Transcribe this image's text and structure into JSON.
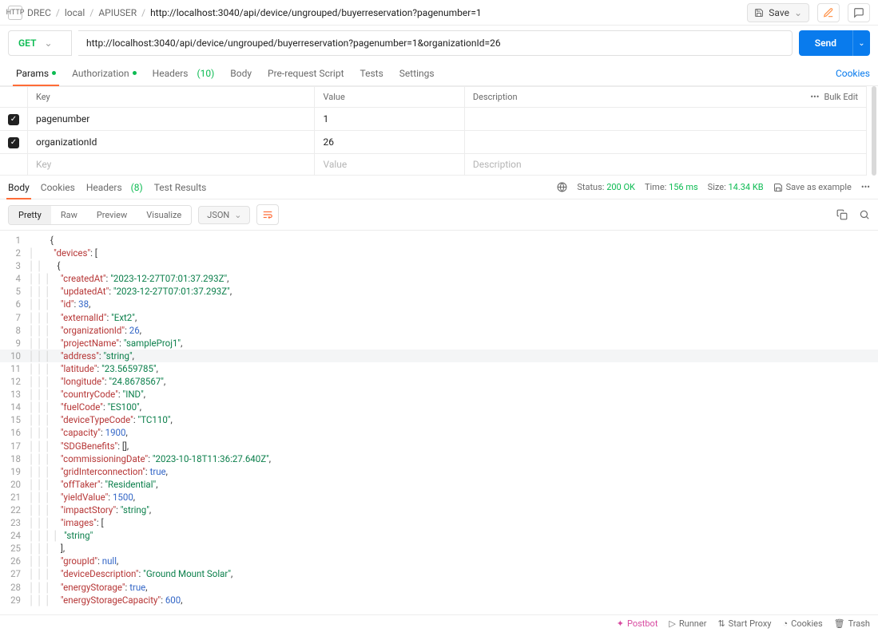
{
  "breadcrumb": {
    "method": "HTTP",
    "a": "DREC",
    "b": "local",
    "c": "APIUSER",
    "url": "http://localhost:3040/api/device/ungrouped/buyerreservation?pagenumber=1"
  },
  "topbar": {
    "save": "Save"
  },
  "request": {
    "method": "GET",
    "url": "http://localhost:3040/api/device/ungrouped/buyerreservation?pagenumber=1&organizationId=26",
    "send": "Send"
  },
  "reqTabs": {
    "params": "Params",
    "auth": "Authorization",
    "headers": "Headers",
    "headers_count": "(10)",
    "body": "Body",
    "prereq": "Pre-request Script",
    "tests": "Tests",
    "settings": "Settings",
    "cookies": "Cookies"
  },
  "paramsHeader": {
    "key": "Key",
    "value": "Value",
    "desc": "Description",
    "bulk": "Bulk Edit"
  },
  "params": [
    {
      "enabled": true,
      "key": "pagenumber",
      "value": "1",
      "desc": ""
    },
    {
      "enabled": true,
      "key": "organizationId",
      "value": "26",
      "desc": ""
    }
  ],
  "newParam": {
    "key": "Key",
    "value": "Value",
    "desc": "Description"
  },
  "respTabs": {
    "body": "Body",
    "cookies": "Cookies",
    "headers": "Headers",
    "headers_count": "(8)",
    "tests": "Test Results"
  },
  "status": {
    "label": "Status:",
    "value": "200 OK",
    "time_label": "Time:",
    "time": "156 ms",
    "size_label": "Size:",
    "size": "14.34 KB",
    "save_example": "Save as example"
  },
  "viewbar": {
    "pretty": "Pretty",
    "raw": "Raw",
    "preview": "Preview",
    "visualize": "Visualize",
    "format": "JSON"
  },
  "chart_data": {
    "type": "table",
    "title": "JSON response (partial)",
    "json": {
      "devices": [
        {
          "createdAt": "2023-12-27T07:01:37.293Z",
          "updatedAt": "2023-12-27T07:01:37.293Z",
          "id": 38,
          "externalId": "Ext2",
          "organizationId": 26,
          "projectName": "sampleProj1",
          "address": "string",
          "latitude": "23.5659785",
          "longitude": "24.8678567",
          "countryCode": "IND",
          "fuelCode": "ES100",
          "deviceTypeCode": "TC110",
          "capacity": 1900,
          "SDGBenefits": [],
          "commissioningDate": "2023-10-18T11:36:27.640Z",
          "gridInterconnection": true,
          "offTaker": "Residential",
          "yieldValue": 1500,
          "impactStory": "string",
          "images": [
            "string"
          ],
          "groupId": null,
          "deviceDescription": "Ground Mount Solar",
          "energyStorage": true,
          "energyStorageCapacity": 600
        }
      ]
    }
  },
  "codeLines": [
    {
      "n": 1,
      "g": "",
      "t": [
        [
          "p",
          "{"
        ]
      ]
    },
    {
      "n": 2,
      "g": "│ ",
      "t": [
        [
          "k",
          "\"devices\""
        ],
        [
          "p",
          ": ["
        ]
      ]
    },
    {
      "n": 3,
      "g": "│ │ ",
      "t": [
        [
          "p",
          "{"
        ]
      ]
    },
    {
      "n": 4,
      "g": "│ │ │ ",
      "t": [
        [
          "k",
          "\"createdAt\""
        ],
        [
          "p",
          ": "
        ],
        [
          "s",
          "\"2023-12-27T07:01:37.293Z\""
        ],
        [
          "p",
          ","
        ]
      ]
    },
    {
      "n": 5,
      "g": "│ │ │ ",
      "t": [
        [
          "k",
          "\"updatedAt\""
        ],
        [
          "p",
          ": "
        ],
        [
          "s",
          "\"2023-12-27T07:01:37.293Z\""
        ],
        [
          "p",
          ","
        ]
      ]
    },
    {
      "n": 6,
      "g": "│ │ │ ",
      "t": [
        [
          "k",
          "\"id\""
        ],
        [
          "p",
          ": "
        ],
        [
          "n",
          "38"
        ],
        [
          "p",
          ","
        ]
      ]
    },
    {
      "n": 7,
      "g": "│ │ │ ",
      "t": [
        [
          "k",
          "\"externalId\""
        ],
        [
          "p",
          ": "
        ],
        [
          "s",
          "\"Ext2\""
        ],
        [
          "p",
          ","
        ]
      ]
    },
    {
      "n": 8,
      "g": "│ │ │ ",
      "t": [
        [
          "k",
          "\"organizationId\""
        ],
        [
          "p",
          ": "
        ],
        [
          "n",
          "26"
        ],
        [
          "p",
          ","
        ]
      ]
    },
    {
      "n": 9,
      "g": "│ │ │ ",
      "t": [
        [
          "k",
          "\"projectName\""
        ],
        [
          "p",
          ": "
        ],
        [
          "s",
          "\"sampleProj1\""
        ],
        [
          "p",
          ","
        ]
      ]
    },
    {
      "n": 10,
      "g": "│ │ │ ",
      "hl": true,
      "t": [
        [
          "k",
          "\"address\""
        ],
        [
          "p",
          ": "
        ],
        [
          "s",
          "\"string\""
        ],
        [
          "p",
          ","
        ]
      ]
    },
    {
      "n": 11,
      "g": "│ │ │ ",
      "t": [
        [
          "k",
          "\"latitude\""
        ],
        [
          "p",
          ": "
        ],
        [
          "s",
          "\"23.5659785\""
        ],
        [
          "p",
          ","
        ]
      ]
    },
    {
      "n": 12,
      "g": "│ │ │ ",
      "t": [
        [
          "k",
          "\"longitude\""
        ],
        [
          "p",
          ": "
        ],
        [
          "s",
          "\"24.8678567\""
        ],
        [
          "p",
          ","
        ]
      ]
    },
    {
      "n": 13,
      "g": "│ │ │ ",
      "t": [
        [
          "k",
          "\"countryCode\""
        ],
        [
          "p",
          ": "
        ],
        [
          "s",
          "\"IND\""
        ],
        [
          "p",
          ","
        ]
      ]
    },
    {
      "n": 14,
      "g": "│ │ │ ",
      "t": [
        [
          "k",
          "\"fuelCode\""
        ],
        [
          "p",
          ": "
        ],
        [
          "s",
          "\"ES100\""
        ],
        [
          "p",
          ","
        ]
      ]
    },
    {
      "n": 15,
      "g": "│ │ │ ",
      "t": [
        [
          "k",
          "\"deviceTypeCode\""
        ],
        [
          "p",
          ": "
        ],
        [
          "s",
          "\"TC110\""
        ],
        [
          "p",
          ","
        ]
      ]
    },
    {
      "n": 16,
      "g": "│ │ │ ",
      "t": [
        [
          "k",
          "\"capacity\""
        ],
        [
          "p",
          ": "
        ],
        [
          "n",
          "1900"
        ],
        [
          "p",
          ","
        ]
      ]
    },
    {
      "n": 17,
      "g": "│ │ │ ",
      "t": [
        [
          "k",
          "\"SDGBenefits\""
        ],
        [
          "p",
          ": [],"
        ]
      ]
    },
    {
      "n": 18,
      "g": "│ │ │ ",
      "t": [
        [
          "k",
          "\"commissioningDate\""
        ],
        [
          "p",
          ": "
        ],
        [
          "s",
          "\"2023-10-18T11:36:27.640Z\""
        ],
        [
          "p",
          ","
        ]
      ]
    },
    {
      "n": 19,
      "g": "│ │ │ ",
      "t": [
        [
          "k",
          "\"gridInterconnection\""
        ],
        [
          "p",
          ": "
        ],
        [
          "n",
          "true"
        ],
        [
          "p",
          ","
        ]
      ]
    },
    {
      "n": 20,
      "g": "│ │ │ ",
      "t": [
        [
          "k",
          "\"offTaker\""
        ],
        [
          "p",
          ": "
        ],
        [
          "s",
          "\"Residential\""
        ],
        [
          "p",
          ","
        ]
      ]
    },
    {
      "n": 21,
      "g": "│ │ │ ",
      "t": [
        [
          "k",
          "\"yieldValue\""
        ],
        [
          "p",
          ": "
        ],
        [
          "n",
          "1500"
        ],
        [
          "p",
          ","
        ]
      ]
    },
    {
      "n": 22,
      "g": "│ │ │ ",
      "t": [
        [
          "k",
          "\"impactStory\""
        ],
        [
          "p",
          ": "
        ],
        [
          "s",
          "\"string\""
        ],
        [
          "p",
          ","
        ]
      ]
    },
    {
      "n": 23,
      "g": "│ │ │ ",
      "t": [
        [
          "k",
          "\"images\""
        ],
        [
          "p",
          ": ["
        ]
      ]
    },
    {
      "n": 24,
      "g": "│ │ │ │ ",
      "t": [
        [
          "s",
          "\"string\""
        ]
      ]
    },
    {
      "n": 25,
      "g": "│ │ │ ",
      "t": [
        [
          "p",
          "],"
        ]
      ]
    },
    {
      "n": 26,
      "g": "│ │ │ ",
      "t": [
        [
          "k",
          "\"groupId\""
        ],
        [
          "p",
          ": "
        ],
        [
          "n",
          "null"
        ],
        [
          "p",
          ","
        ]
      ]
    },
    {
      "n": 27,
      "g": "│ │ │ ",
      "t": [
        [
          "k",
          "\"deviceDescription\""
        ],
        [
          "p",
          ": "
        ],
        [
          "s",
          "\"Ground Mount Solar\""
        ],
        [
          "p",
          ","
        ]
      ]
    },
    {
      "n": 28,
      "g": "│ │ │ ",
      "t": [
        [
          "k",
          "\"energyStorage\""
        ],
        [
          "p",
          ": "
        ],
        [
          "n",
          "true"
        ],
        [
          "p",
          ","
        ]
      ]
    },
    {
      "n": 29,
      "g": "│ │ │ ",
      "t": [
        [
          "k",
          "\"energyStorageCapacity\""
        ],
        [
          "p",
          ": "
        ],
        [
          "n",
          "600"
        ],
        [
          "p",
          ","
        ]
      ]
    }
  ],
  "footer": {
    "postbot": "Postbot",
    "runner": "Runner",
    "startproxy": "Start Proxy",
    "cookies": "Cookies",
    "trash": "Trash"
  }
}
